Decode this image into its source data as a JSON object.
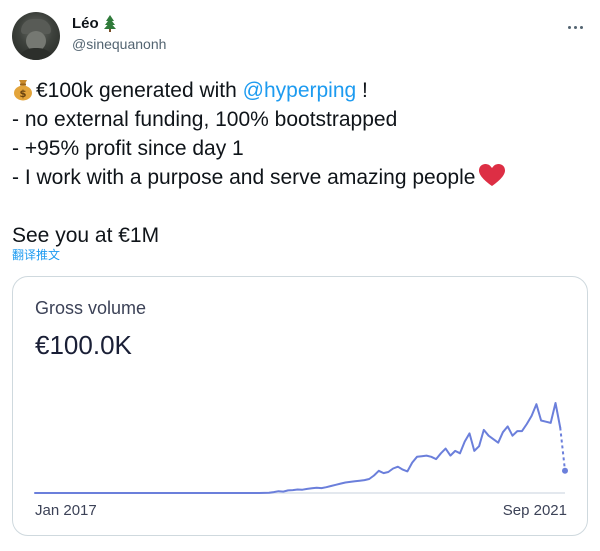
{
  "author": {
    "name": "Léo",
    "name_icon": "christmas-tree-icon",
    "handle": "@sinequanonh"
  },
  "menu_icon": "more-horizontal-icon",
  "tweet": {
    "line1_before": "€100k generated with ",
    "line1_mention": "@hyperping",
    "line1_after": " !",
    "line1_icon": "money-bag-icon",
    "line2": "- no external funding, 100% bootstrapped",
    "line3": "- +95% profit since day 1",
    "line4": "-  I work with a purpose and serve amazing people",
    "line4_icon": "red-heart-icon",
    "line6": "See you at €1M"
  },
  "translate_label": "翻译推文",
  "card": {
    "title": "Gross volume",
    "value": "€100.0K",
    "x_start_label": "Jan 2017",
    "x_end_label": "Sep 2021",
    "line_color": "#6b7fdb",
    "axis_color": "#e3e8ee"
  },
  "chart_data": {
    "type": "line",
    "title": "Gross volume",
    "xlabel": "",
    "ylabel": "",
    "x_range": [
      "Jan 2017",
      "Sep 2021"
    ],
    "ylim": [
      0,
      6000
    ],
    "grid": false,
    "series": [
      {
        "values": [
          0,
          0,
          0,
          0,
          0,
          0,
          0,
          0,
          0,
          0,
          0,
          0,
          0,
          0,
          0,
          0,
          0,
          0,
          0,
          0,
          0,
          0,
          0,
          0,
          0,
          0,
          0,
          0,
          0,
          0,
          0,
          0,
          0,
          0,
          0,
          0,
          0,
          0,
          0,
          0,
          0,
          0,
          0,
          0,
          0,
          0,
          0,
          0,
          10,
          20,
          80,
          150,
          120,
          220,
          250,
          300,
          280,
          350,
          400,
          450,
          420,
          500,
          600,
          700,
          800,
          900,
          950,
          1000,
          1050,
          1100,
          1200,
          1500,
          1900,
          1700,
          1800,
          2100,
          2250,
          2000,
          1850,
          2600,
          3100,
          3150,
          3200,
          3100,
          2900,
          3400,
          3800,
          3200,
          3600,
          3400,
          4400,
          5100,
          3600,
          4000,
          5400,
          4900,
          4600,
          4300,
          5200,
          5700,
          4900,
          5300,
          5300,
          5900,
          6600,
          7600,
          6200,
          6100,
          6000,
          7700,
          5600,
          1900
        ],
        "last_point_dashed": true
      }
    ]
  }
}
